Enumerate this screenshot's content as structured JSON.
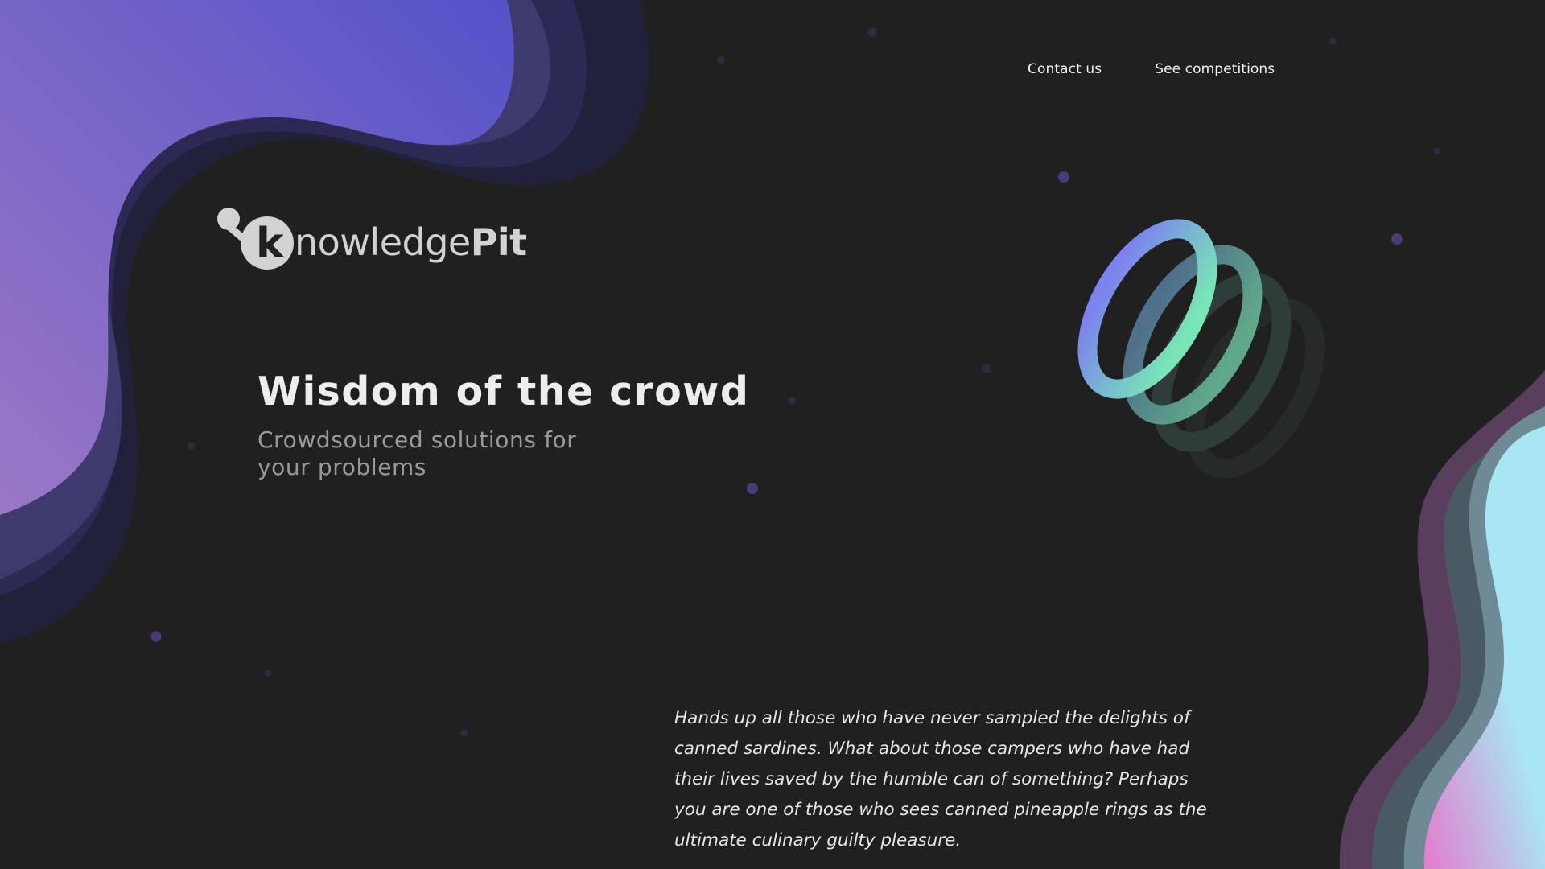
{
  "nav": {
    "contact_label": "Contact us",
    "competitions_label": "See competitions"
  },
  "logo": {
    "letter": "k",
    "word_light": "nowledge",
    "word_bold": "Pit"
  },
  "hero": {
    "title": "Wisdom of the crowd",
    "subtitle_line1": "Crowdsourced solutions for",
    "subtitle_line2": "your problems"
  },
  "quote": {
    "text": "Hands up all those who have never sampled the delights of canned sardines. What about those campers who have had their lives saved by the humble can of something? Perhaps you are one of those who sees canned pineapple rings as the ultimate culinary guilty pleasure."
  },
  "colors": {
    "background": "#202020",
    "blob_purple": "#5b57c8",
    "blob_violet": "#9a76c4",
    "blob_cyan": "#a9e6f2",
    "blob_pink": "#e07ccd",
    "ring_mint": "#76e6b4",
    "dot": "#4b3a7a"
  }
}
